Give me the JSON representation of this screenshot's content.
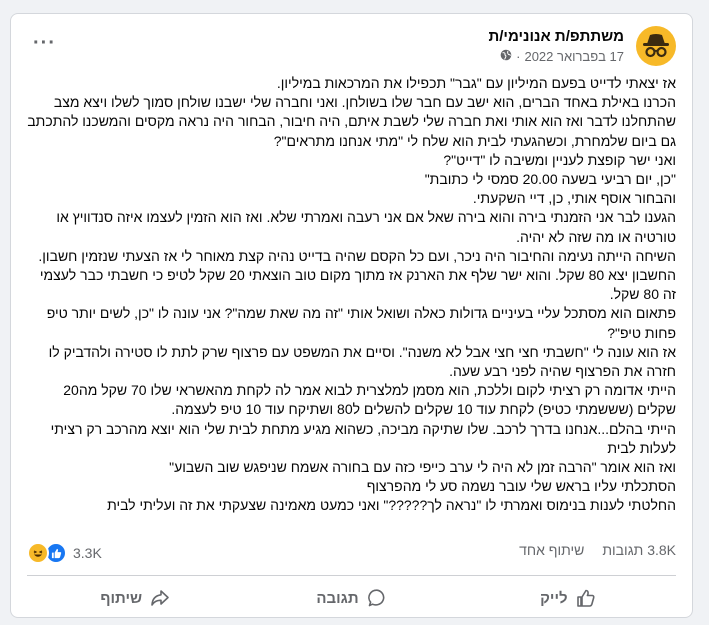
{
  "post": {
    "author": "משתתפ/ת אנונימי/ת",
    "date": "17 בפברואר 2022",
    "more_icon": "···",
    "paragraphs": [
      "אז יצאתי לדייט בפעם המיליון עם \"גבר\" תכפילו את המרכאות במיליון.",
      "הכרנו באילת באחד הברים, הוא ישב עם חבר שלו בשולחן. ואני וחברה שלי ישבנו שולחן סמוך לשלו ויצא מצב שהתחלנו לדבר ואז הוא אותי ואת חברה שלי לשבת איתם, היה חיבור, הבחור היה נראה מקסים והמשכנו להתכתב גם ביום שלמחרת, וכשהגעתי לבית הוא שלח לי \"מתי אנחנו מתראים\"?",
      "ואני ישר קופצת לעניין ומשיבה לו \"דייט\"?",
      "\"כן, יום רביעי בשעה 20.00 סמסי לי כתובת\"",
      "והבחור אוסף אותי, כן, דיי השקעתי.",
      "הגענו לבר אני הזמנתי בירה והוא בירה שאל אם אני רעבה ואמרתי שלא. ואז הוא הזמין לעצמו איזה סנדוויץ או טורטיה או מה שזה לא יהיה.",
      "השיחה הייתה נעימה והחיבור היה ניכר, ועם כל הקסם שהיה בדייט נהיה קצת מאוחר לי אז הצעתי שנזמין חשבון. החשבון יצא 80 שקל. והוא ישר שלף את הארנק אז מתוך מקום טוב הוצאתי 20 שקל לטיפ כי חשבתי כבר לעצמי זה 80 שקל.",
      "פתאום הוא מסתכל עליי בעיניים גדולות כאלה ושואל אותי \"זה מה שאת שמה\"? אני עונה לו \"כן, לשים יותר טיפ פחות טיפ\"?",
      "אז הוא עונה לי \"חשבתי חצי חצי אבל לא משנה\". וסיים את המשפט עם פרצוף שרק לתת לו סטירה ולהדביק לו חזרה את הפרצוף שהיה לפני רבע שעה.",
      "הייתי אדומה רק רציתי לקום וללכת, הוא מסמן למלצרית לבוא  אמר לה לקחת מהאשראי שלו 70 שקל מה20 שקלים (שששמתי כטיפ) לקחת עוד 10 שקלים להשלים ל80 ושתיקח עוד 10 טיפ לעצמה.",
      "הייתי בהלם...אנחנו בדרך לרכב. שלו שתיקה מביכה, כשהוא מגיע מתחת לבית שלי הוא יוצא מהרכב רק רציתי לעלות לבית",
      "ואז הוא אומר \"הרבה זמן לא היה לי ערב כייפי כזה עם בחורה אשמח שניפגש שוב השבוע\"",
      "הסתכלתי עליו בראש שלי עובר נשמה סע לי מהפרצוף",
      "החלטתי לענות בנימוס ואמרתי לו \"נראה לך?????\" ואני כמעט מאמינה שצעקתי את זה ועליתי לבית"
    ]
  },
  "stats": {
    "reactions_count": "3.3K",
    "comments": "3.8K תגובות",
    "shares": "שיתוף אחד"
  },
  "actions": {
    "like": "לייק",
    "comment": "תגובה",
    "share": "שיתוף"
  },
  "icons": {
    "avatar": "incognito-avatar-icon",
    "privacy": "globe-icon",
    "like": "like-icon",
    "comment": "comment-icon",
    "share": "share-icon"
  },
  "colors": {
    "accent": "#1877f2",
    "avatar_bg": "#f7b928",
    "secondary_text": "#65676b"
  }
}
